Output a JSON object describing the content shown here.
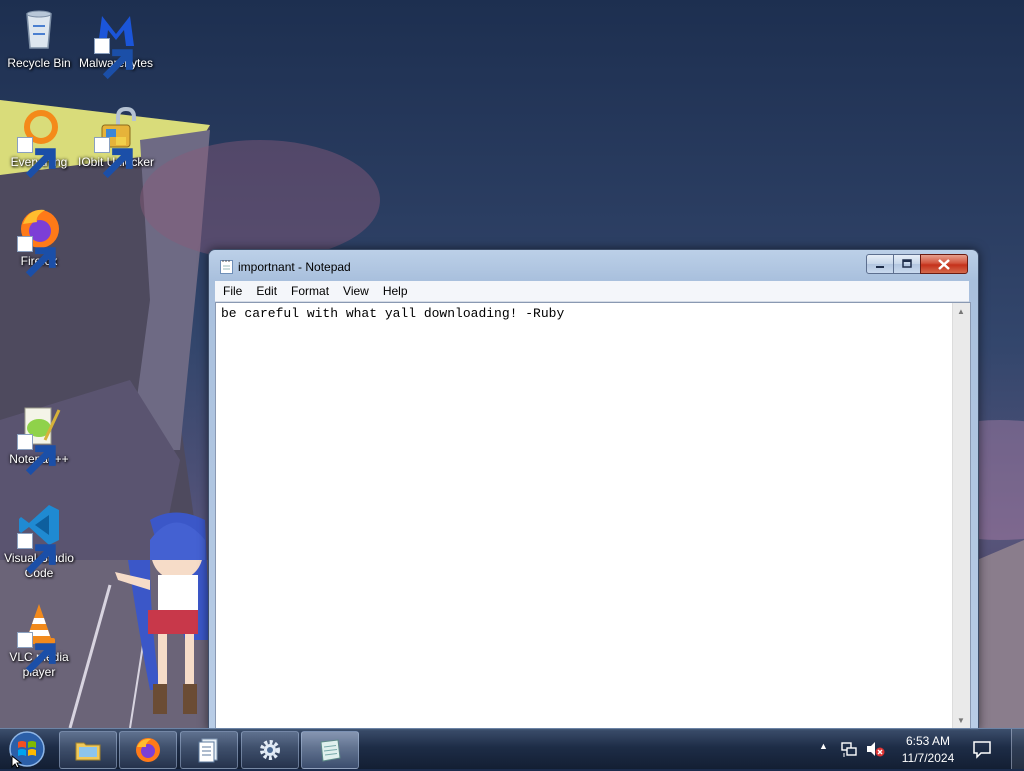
{
  "desktop": {
    "icons": [
      {
        "id": "recycle-bin",
        "label": "Recycle Bin"
      },
      {
        "id": "malwarebytes",
        "label": "Malwarebytes"
      },
      {
        "id": "everything",
        "label": "Everything"
      },
      {
        "id": "iobit",
        "label": "IObit Unlocker"
      },
      {
        "id": "firefox",
        "label": "Firefox"
      },
      {
        "id": "notepadpp",
        "label": "Notepad++"
      },
      {
        "id": "vscode",
        "label": "Visual Studio Code"
      },
      {
        "id": "vlc",
        "label": "VLC media player"
      }
    ]
  },
  "notepad": {
    "title": "importnant - Notepad",
    "menu": [
      "File",
      "Edit",
      "Format",
      "View",
      "Help"
    ],
    "content": "be careful with what yall downloading! -Ruby"
  },
  "taskbar": {
    "pinned": [
      "file-explorer",
      "firefox",
      "document-viewer",
      "settings",
      "notepad"
    ],
    "clock_time": "6:53 AM",
    "clock_date": "11/7/2024"
  },
  "icons": {
    "minimize": "minimize-icon",
    "maximize": "maximize-icon",
    "close": "close-icon",
    "network": "network-icon",
    "volume": "volume-muted-icon",
    "notifications": "action-center-icon"
  },
  "colors": {
    "title_bar": "#bcd0e8",
    "close_button": "#c5311b",
    "taskbar": "#1c2c46"
  }
}
